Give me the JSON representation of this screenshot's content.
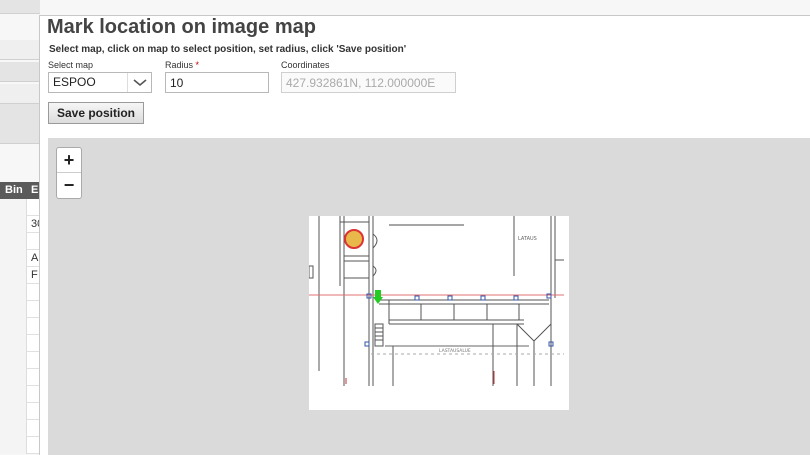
{
  "background": {
    "header_cells": [
      "Bin",
      "E"
    ],
    "row_texts": [
      "",
      "30",
      "",
      "A",
      "F",
      "",
      "",
      "",
      "",
      "",
      "",
      "",
      "",
      "",
      ""
    ]
  },
  "dialog": {
    "title": "Mark location on image map",
    "instructions": "Select map, click on map to select position, set radius, click 'Save position'",
    "select_map_label": "Select map",
    "select_map_value": "ESPOO",
    "radius_label": "Radius",
    "radius_required": "*",
    "radius_value": "10",
    "coordinates_label": "Coordinates",
    "coordinates_value": "427.932861N, 112.000000E",
    "save_button": "Save position"
  },
  "map": {
    "zoom_in": "+",
    "zoom_out": "−",
    "marker_color": "#e8b84a",
    "pin_color": "#22cc22"
  }
}
